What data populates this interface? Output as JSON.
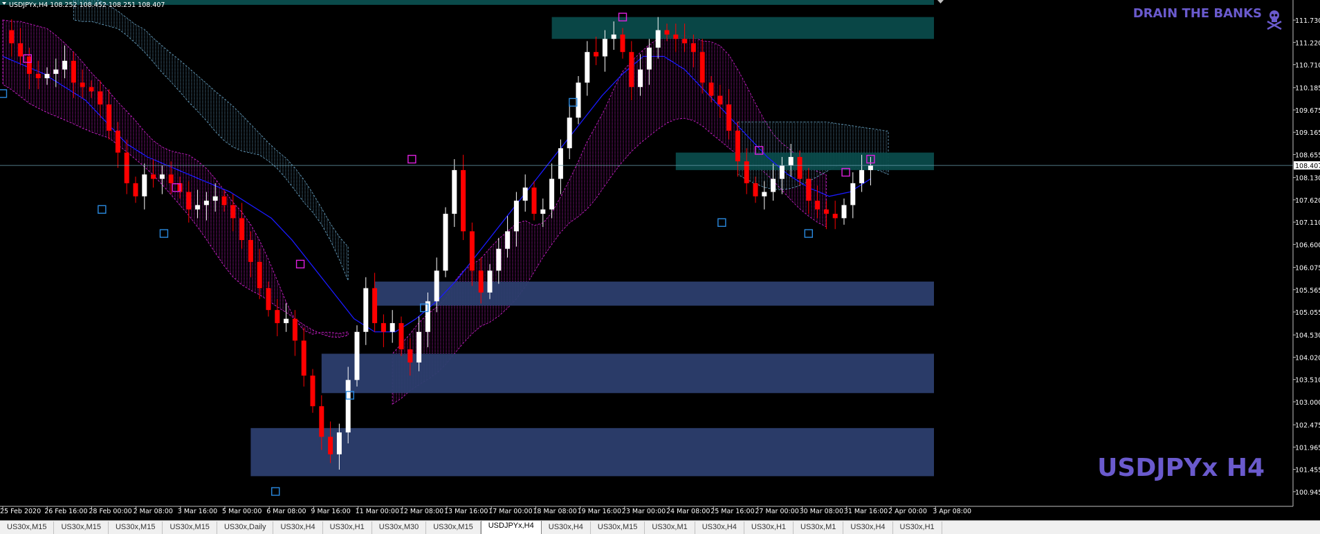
{
  "window": {
    "symbol_info": "USDJPYx,H4  108.252 108.452 108.251 108.407"
  },
  "watermark": {
    "brand": "DRAIN THE BANKS",
    "symbol": "USDJPYx H4",
    "skull_icon": "skull-crossbones-icon"
  },
  "colors": {
    "background": "#000000",
    "bull": "#ffffff",
    "bear": "#ff0000",
    "ma": "#1a1aff",
    "cloud_bull": "#6aa6c8",
    "cloud_bear": "#d020d0",
    "supply_zone": "#0a4a4a",
    "demand_zone": "#2c3e6e",
    "fractal_up": "#e020e0",
    "fractal_down": "#2a8ae0",
    "watermark": "#6a5acd",
    "bid_line": "#6aa0b0"
  },
  "chart_data": {
    "type": "candlestick",
    "symbol": "USDJPYx",
    "timeframe": "H4",
    "ohlc_current": {
      "open": 108.252,
      "high": 108.452,
      "low": 108.251,
      "close": 108.407
    },
    "current_price": 108.407,
    "ylim": [
      100.8,
      112.0
    ],
    "y_ticks": [
      "111.730",
      "111.220",
      "110.710",
      "110.185",
      "109.675",
      "109.165",
      "108.655",
      "108.130",
      "107.620",
      "107.110",
      "106.600",
      "106.075",
      "105.565",
      "105.055",
      "104.530",
      "104.020",
      "103.510",
      "103.000",
      "102.475",
      "101.965",
      "101.455",
      "100.945"
    ],
    "x_ticks": [
      "25 Feb 2020",
      "26 Feb 16:00",
      "28 Feb 00:00",
      "2 Mar 08:00",
      "3 Mar 16:00",
      "5 Mar 00:00",
      "6 Mar 08:00",
      "9 Mar 16:00",
      "11 Mar 00:00",
      "12 Mar 08:00",
      "13 Mar 16:00",
      "17 Mar 00:00",
      "18 Mar 08:00",
      "19 Mar 16:00",
      "23 Mar 00:00",
      "24 Mar 08:00",
      "25 Mar 16:00",
      "27 Mar 00:00",
      "30 Mar 08:00",
      "31 Mar 16:00",
      "2 Apr 00:00",
      "3 Apr 08:00"
    ],
    "price_path": [
      111.5,
      111.2,
      110.9,
      110.5,
      110.4,
      110.5,
      110.6,
      110.8,
      110.3,
      110.2,
      110.1,
      109.8,
      109.2,
      108.7,
      108.0,
      107.7,
      108.2,
      108.1,
      108.2,
      108.0,
      107.8,
      107.4,
      107.5,
      107.6,
      107.7,
      107.5,
      107.2,
      106.7,
      106.2,
      105.6,
      105.1,
      104.8,
      104.9,
      104.4,
      103.6,
      102.9,
      102.2,
      101.8,
      102.3,
      103.5,
      104.6,
      105.6,
      104.8,
      104.6,
      104.8,
      104.2,
      103.9,
      104.6,
      105.3,
      106.0,
      107.3,
      108.3,
      106.9,
      106.0,
      105.5,
      106.0,
      106.5,
      106.9,
      107.6,
      107.9,
      107.3,
      107.4,
      108.1,
      108.8,
      109.5,
      110.3,
      111.0,
      110.9,
      111.3,
      111.4,
      111.0,
      110.2,
      110.6,
      111.1,
      111.5,
      111.4,
      111.3,
      111.2,
      111.0,
      110.3,
      110.0,
      109.8,
      109.2,
      108.5,
      108.0,
      107.7,
      107.8,
      108.1,
      108.4,
      108.6,
      108.1,
      107.6,
      107.4,
      107.3,
      107.2,
      107.5,
      108.0,
      108.3,
      108.4
    ],
    "ma_path": [
      110.9,
      110.7,
      110.5,
      110.2,
      109.9,
      109.4,
      108.9,
      108.6,
      108.4,
      108.2,
      108.0,
      107.8,
      107.5,
      107.2,
      106.7,
      106.1,
      105.5,
      104.9,
      104.6,
      104.6,
      104.9,
      105.3,
      105.8,
      106.4,
      107.0,
      107.6,
      108.2,
      108.8,
      109.4,
      110.0,
      110.5,
      110.9,
      110.9,
      110.6,
      110.1,
      109.6,
      109.1,
      108.6,
      108.2,
      107.9,
      107.7,
      107.8,
      108.1
    ],
    "fractals_up": [
      [
        2,
        110.85
      ],
      [
        14,
        107.9
      ],
      [
        24,
        106.15
      ],
      [
        33,
        108.55
      ],
      [
        50,
        111.8
      ],
      [
        61,
        108.75
      ],
      [
        68,
        108.25
      ],
      [
        70,
        108.55
      ]
    ],
    "fractals_down": [
      [
        0,
        110.05
      ],
      [
        8,
        107.4
      ],
      [
        13,
        106.85
      ],
      [
        22,
        100.95
      ],
      [
        28,
        103.15
      ],
      [
        34,
        105.15
      ],
      [
        46,
        109.85
      ],
      [
        58,
        107.1
      ],
      [
        65,
        106.85
      ]
    ],
    "zones": [
      {
        "kind": "supply",
        "top": 111.8,
        "bottom": 111.3
      },
      {
        "kind": "supply",
        "top": 108.7,
        "bottom": 108.3
      },
      {
        "kind": "demand",
        "top": 105.75,
        "bottom": 105.2
      },
      {
        "kind": "demand",
        "top": 104.1,
        "bottom": 103.2
      },
      {
        "kind": "demand",
        "top": 102.4,
        "bottom": 101.3
      }
    ]
  },
  "tabs": [
    {
      "label": "US30x,M15"
    },
    {
      "label": "US30x,M15"
    },
    {
      "label": "US30x,M15"
    },
    {
      "label": "US30x,M15"
    },
    {
      "label": "US30x,Daily"
    },
    {
      "label": "US30x,H4"
    },
    {
      "label": "US30x,H1"
    },
    {
      "label": "US30x,M30"
    },
    {
      "label": "US30x,M15"
    },
    {
      "label": "USDJPYx,H4",
      "active": true
    },
    {
      "label": "US30x,H4"
    },
    {
      "label": "US30x,M15"
    },
    {
      "label": "US30x,M1"
    },
    {
      "label": "US30x,H4"
    },
    {
      "label": "US30x,H1"
    },
    {
      "label": "US30x,M1"
    },
    {
      "label": "US30x,H4"
    },
    {
      "label": "US30x,H1"
    }
  ]
}
